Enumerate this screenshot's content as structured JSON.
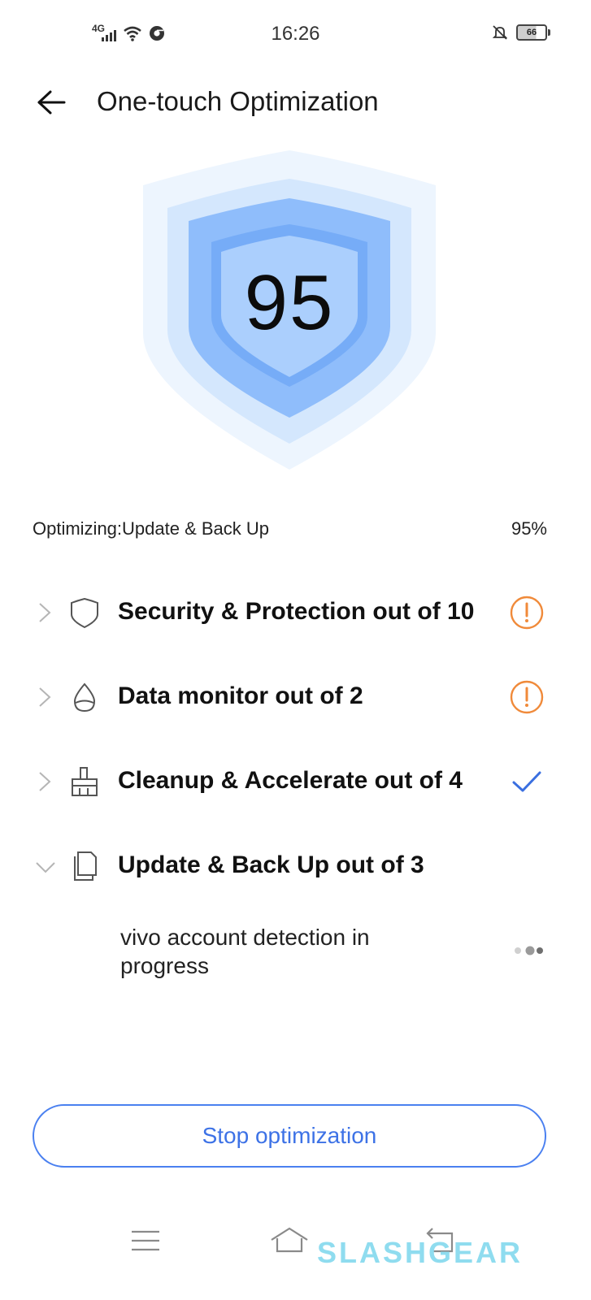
{
  "status_bar": {
    "time": "16:26",
    "network": "4G",
    "battery_level": "66",
    "icons": [
      "signal-icon",
      "wifi-icon",
      "chrome-icon",
      "notifications-off-icon",
      "battery-icon"
    ]
  },
  "header": {
    "title": "One-touch Optimization",
    "back_icon": "arrow-left-icon"
  },
  "score": {
    "value": "95",
    "shield_colors": [
      "#eaf3fe",
      "#d3e6fd",
      "#8ebcfb",
      "#a9cdfd"
    ]
  },
  "progress": {
    "label": "Optimizing:Update & Back Up",
    "percent": "95%"
  },
  "categories": [
    {
      "label": "Security & Protection out of 10",
      "icon": "shield-icon",
      "status": "warning",
      "expanded": false
    },
    {
      "label": "Data monitor out of 2",
      "icon": "drop-icon",
      "status": "warning",
      "expanded": false
    },
    {
      "label": "Cleanup & Accelerate out of 4",
      "icon": "broom-icon",
      "status": "done",
      "expanded": false
    },
    {
      "label": "Update & Back Up out of 3",
      "icon": "document-icon",
      "status": "in-progress",
      "expanded": true
    }
  ],
  "sub_item": {
    "label": "vivo account detection in progress"
  },
  "stop_button": {
    "label": "Stop optimization"
  },
  "nav": {
    "icons": [
      "menu-icon",
      "home-icon",
      "back-icon"
    ]
  },
  "watermark": "SLASHGEAR",
  "colors": {
    "accent": "#3d72e6",
    "warning": "#f08a3a",
    "check": "#3a6fe0"
  }
}
